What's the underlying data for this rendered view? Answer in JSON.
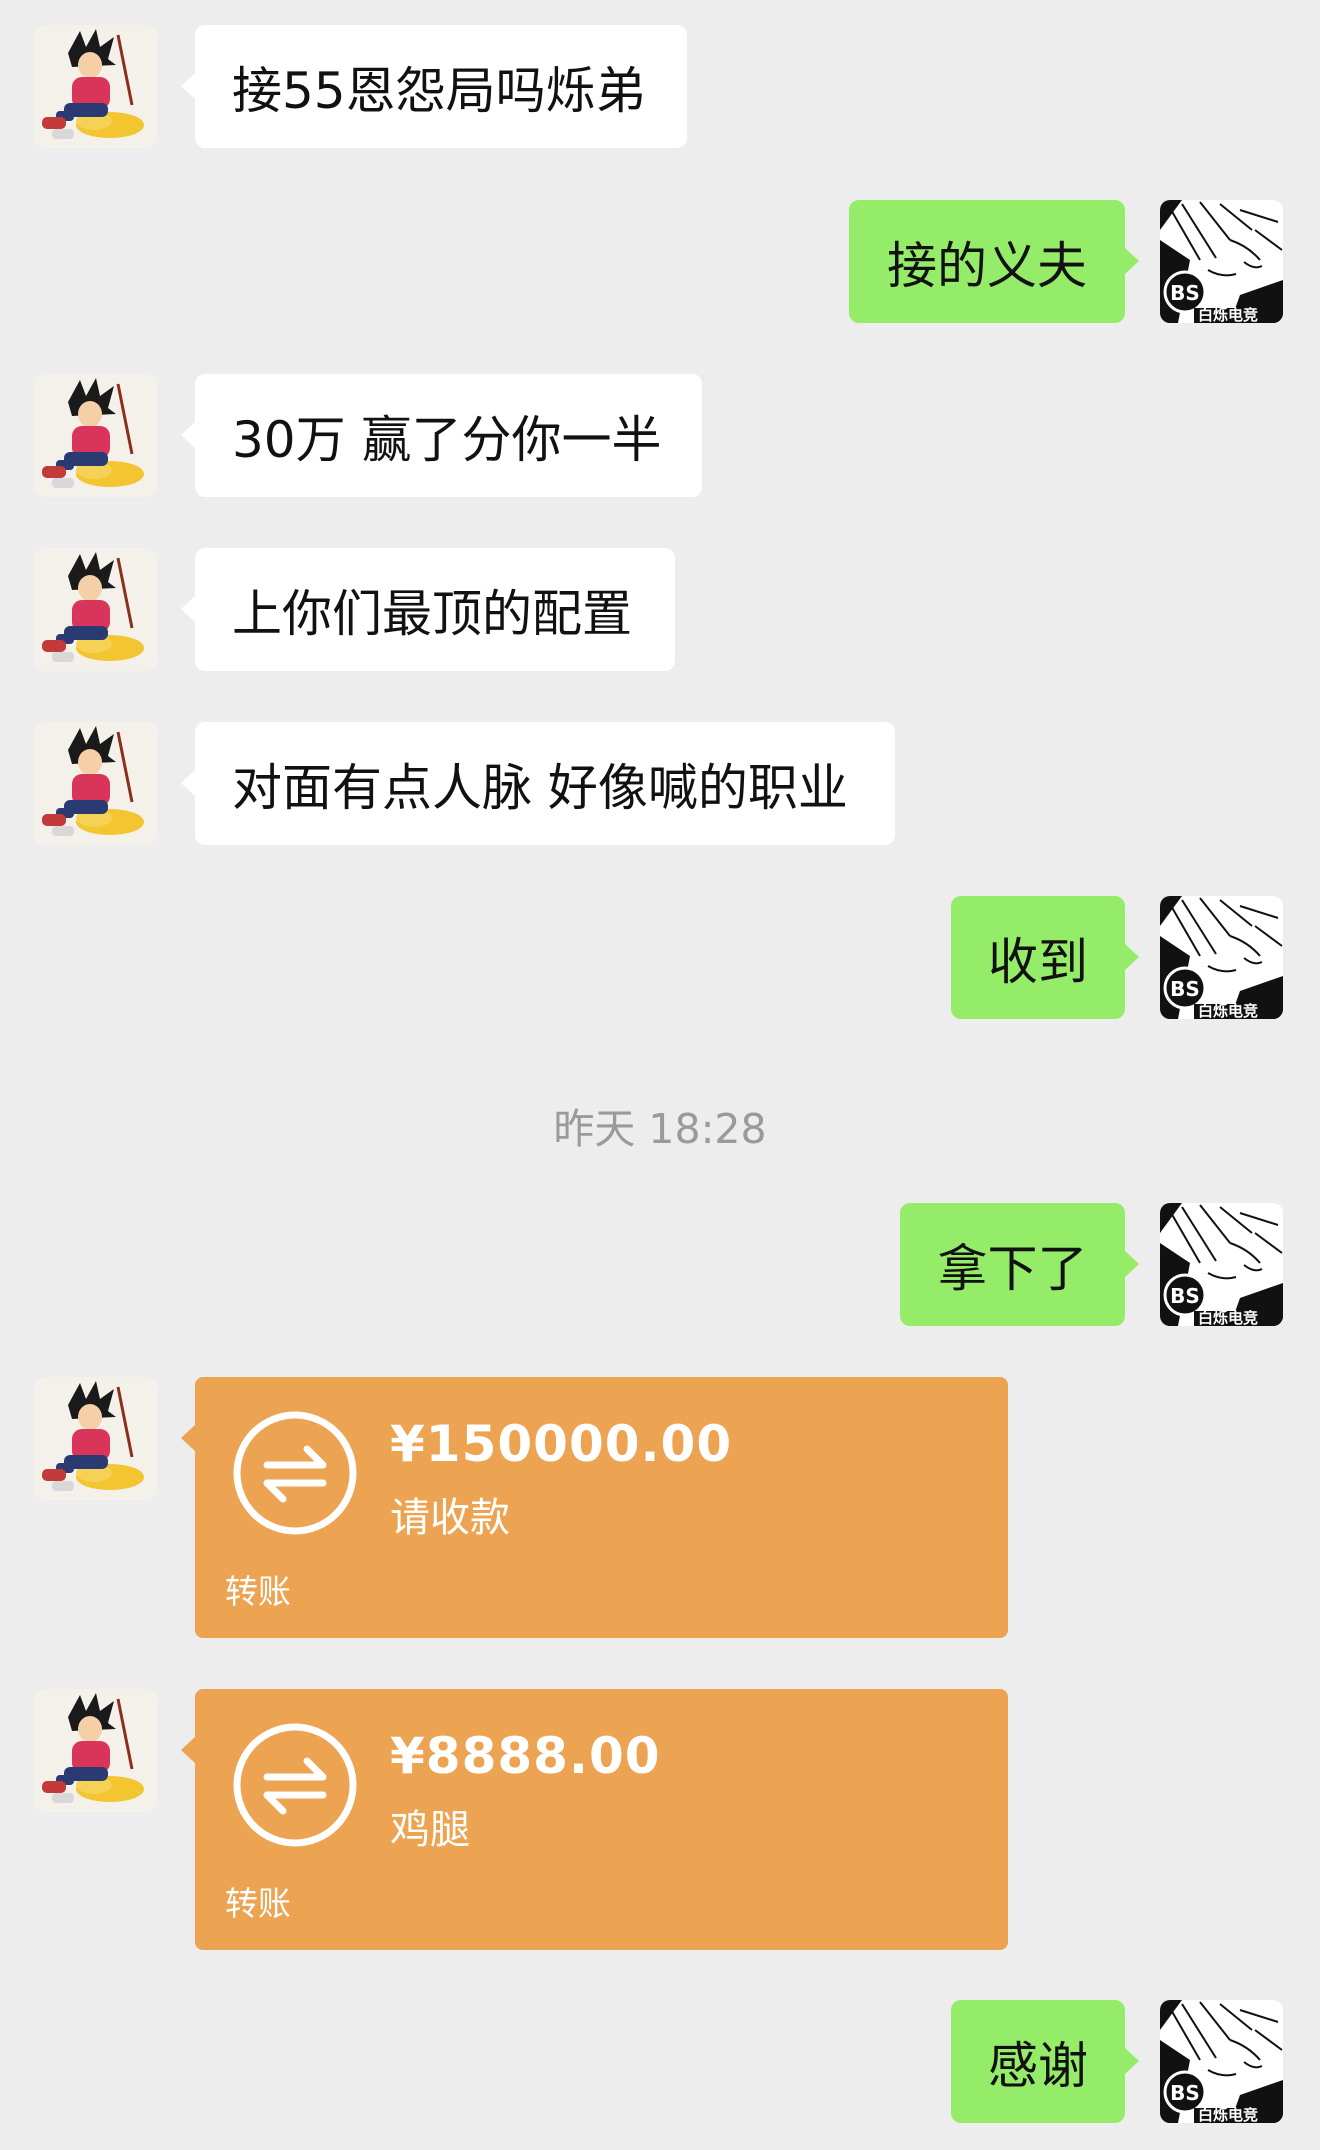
{
  "messages": [
    {
      "side": "in",
      "text": "接55恩怨局吗烁弟"
    },
    {
      "side": "out",
      "text": "接的义夫"
    },
    {
      "side": "in",
      "text": "30万 赢了分你一半"
    },
    {
      "side": "in",
      "text": "上你们最顶的配置"
    },
    {
      "side": "in",
      "text": "对面有点人脉 好像喊的职业"
    },
    {
      "side": "out",
      "text": "收到"
    },
    {
      "side": "out",
      "text": "拿下了"
    },
    {
      "side": "out",
      "text": "感谢"
    }
  ],
  "timestamp": "昨天 18:28",
  "transfers": [
    {
      "amount": "¥150000.00",
      "note": "请收款",
      "kind": "转账"
    },
    {
      "amount": "¥8888.00",
      "note": "鸡腿",
      "kind": "转账"
    }
  ],
  "avatars": {
    "contact_icon": "anime-boy-avatar-icon",
    "self_icon": "anime-logo-avatar-icon",
    "self_logo_text": "BS",
    "self_caption": "白烁电竞"
  },
  "colors": {
    "background": "#ededed",
    "incoming_bubble": "#ffffff",
    "outgoing_bubble": "#95ec69",
    "transfer_card": "#eca352",
    "timestamp_text": "#9a9a9a"
  }
}
